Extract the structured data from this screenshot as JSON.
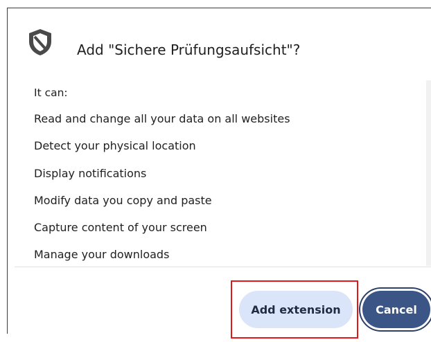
{
  "dialog": {
    "icon": "shield-icon",
    "title": "Add \"Sichere Prüfungsaufsicht\"?",
    "permissions_lead": "It can:",
    "permissions": [
      "Read and change all your data on all websites",
      "Detect your physical location",
      "Display notifications",
      "Modify data you copy and paste",
      "Capture content of your screen",
      "Manage your downloads"
    ],
    "buttons": {
      "add_label": "Add extension",
      "cancel_label": "Cancel"
    }
  },
  "colors": {
    "primary_button": "#3b5586",
    "secondary_button": "#dbe5f9",
    "highlight_box": "#e01818"
  }
}
